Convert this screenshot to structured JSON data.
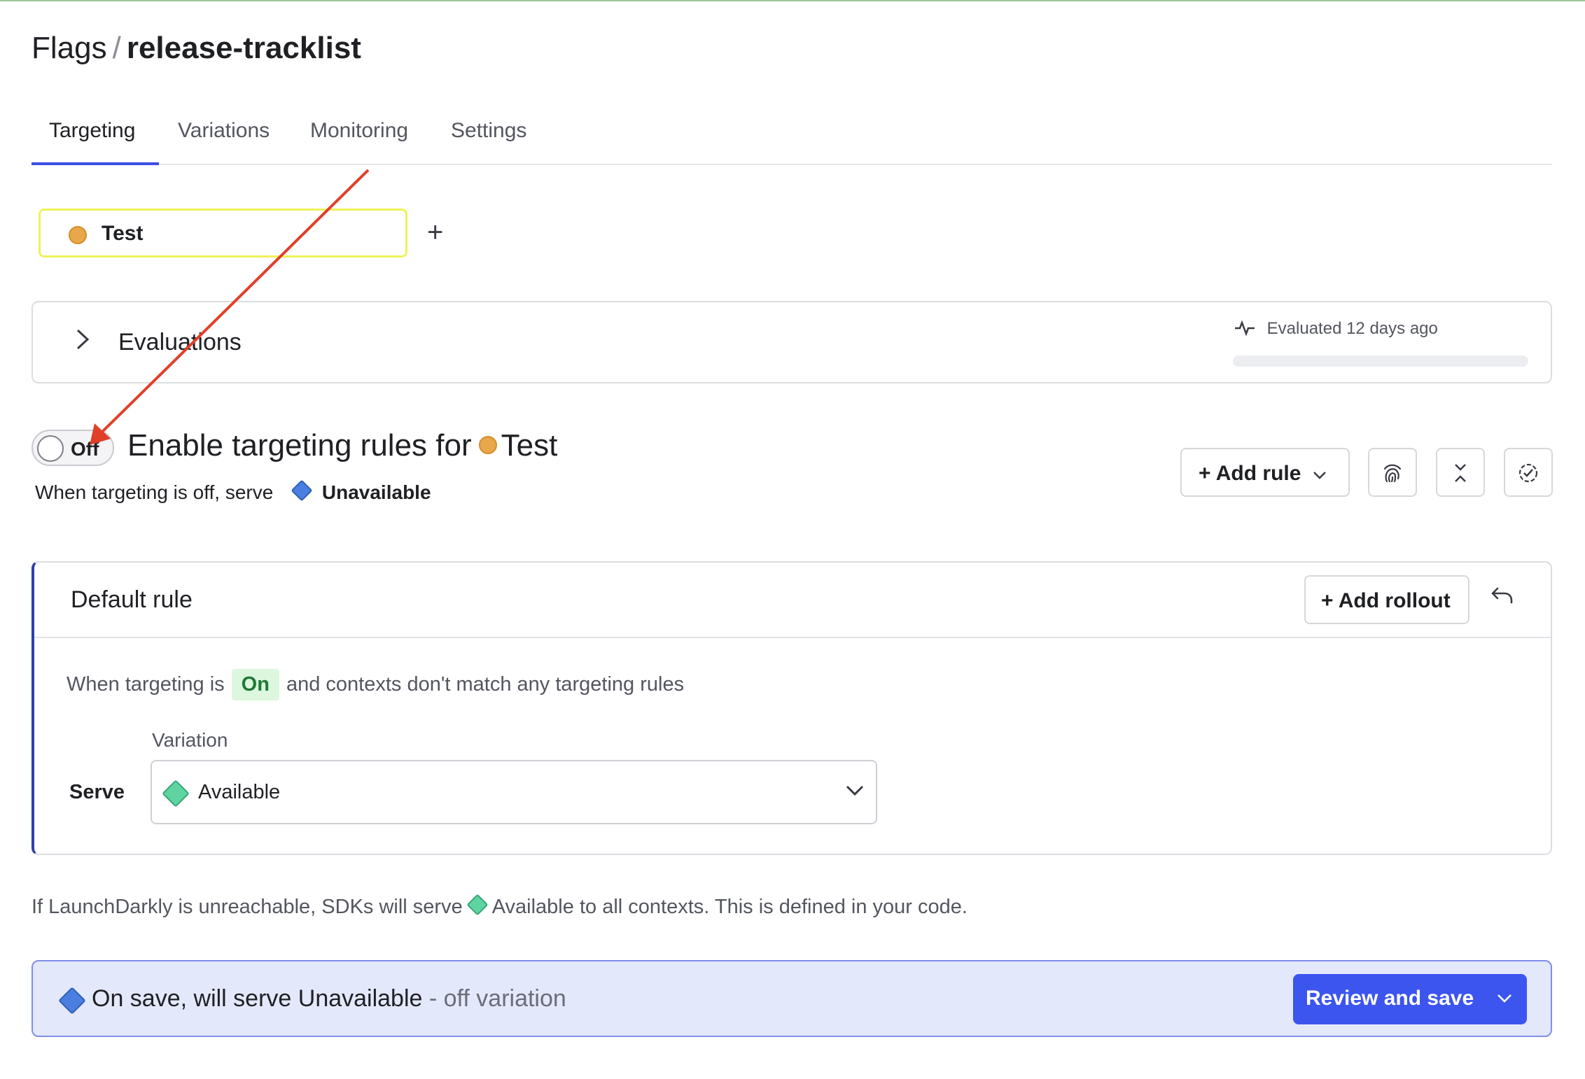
{
  "breadcrumb": {
    "root": "Flags",
    "separator": "/",
    "flag_key": "release-tracklist"
  },
  "tabs": [
    {
      "label": "Targeting",
      "active": true
    },
    {
      "label": "Variations",
      "active": false
    },
    {
      "label": "Monitoring",
      "active": false
    },
    {
      "label": "Settings",
      "active": false
    }
  ],
  "environment": {
    "name": "Test",
    "color": "#e8a74a",
    "add_icon": "plus-icon"
  },
  "evaluations": {
    "title": "Evaluations",
    "status": "Evaluated 12 days ago",
    "chevron_icon": "chevron-right-icon",
    "status_icon": "pulse-icon"
  },
  "targeting": {
    "toggle_label": "Off",
    "toggle_state": "off",
    "title_prefix": "Enable targeting rules for",
    "env_name": "Test",
    "off_serve_prefix": "When targeting is off, serve",
    "off_variation": "Unavailable",
    "off_variation_color": "#4a7fe0"
  },
  "toolbar": {
    "add_rule_label": "Add rule",
    "icons": [
      "fingerprint-icon",
      "collapse-icon",
      "check-circle-icon"
    ]
  },
  "default_rule": {
    "title": "Default rule",
    "add_rollout_label": "Add rollout",
    "undo_icon": "undo-icon",
    "desc_prefix": "When targeting is",
    "desc_badge": "On",
    "desc_suffix": "and contexts don't match any targeting rules",
    "variation_label": "Variation",
    "serve_label": "Serve",
    "selected_variation": "Available",
    "selected_variation_color": "#5fd3a1"
  },
  "fallback": {
    "prefix": "If LaunchDarkly is unreachable, SDKs will serve",
    "variation": "Available",
    "suffix": "to all contexts. This is defined in your code."
  },
  "save_bar": {
    "main_text": "On save, will serve Unavailable",
    "muted_text": " - off variation",
    "review_label": "Review and save"
  },
  "colors": {
    "accent": "#3c55ef",
    "annotation_arrow": "#e0402a",
    "env_highlight": "#eef25a"
  }
}
